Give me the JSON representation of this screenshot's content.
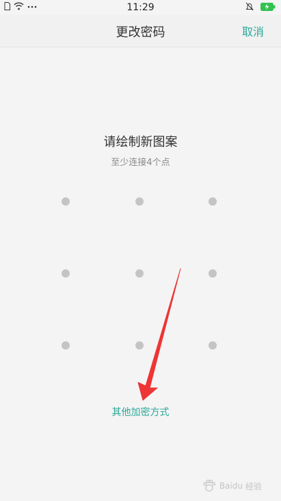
{
  "status_bar": {
    "time": "11:29",
    "left_icons": [
      "sim-icon",
      "wifi-icon",
      "more-dots-icon"
    ],
    "right_icons": [
      "bell-muted-icon",
      "battery-charging-icon"
    ]
  },
  "nav": {
    "title": "更改密码",
    "cancel_label": "取消"
  },
  "prompt": {
    "title": "请绘制新图案",
    "subtitle": "至少连接4个点"
  },
  "pattern": {
    "rows": 3,
    "cols": 3,
    "dot_color": "#c4c4c4"
  },
  "other_method_label": "其他加密方式",
  "colors": {
    "accent": "#2aa89a",
    "annotation_arrow": "#ee3535"
  },
  "watermark": {
    "logo_text": "Baidu",
    "suffix": "经验"
  }
}
